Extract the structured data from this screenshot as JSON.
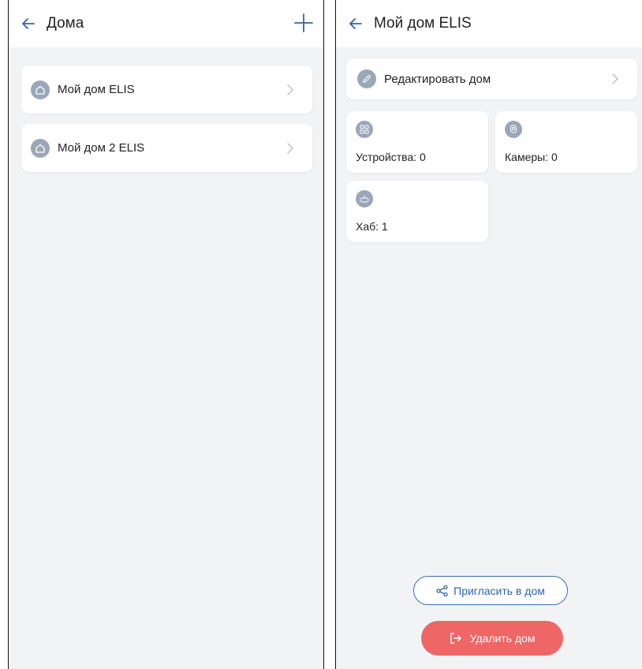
{
  "left_screen": {
    "header": {
      "title": "Дома",
      "back_icon": "arrow-left-icon",
      "add_icon": "plus-icon"
    },
    "homes": [
      {
        "name": "Мой дом ELIS",
        "icon": "home-icon"
      },
      {
        "name": "Мой дом 2 ELIS",
        "icon": "home-icon"
      }
    ]
  },
  "right_screen": {
    "header": {
      "title": "Мой дом ELIS",
      "back_icon": "arrow-left-icon"
    },
    "edit": {
      "label": "Редактировать дом",
      "icon": "pencil-icon"
    },
    "tiles": [
      {
        "label": "Устройства: 0",
        "icon": "devices-grid-icon"
      },
      {
        "label": "Камеры: 0",
        "icon": "camera-icon"
      },
      {
        "label": "Хаб: 1",
        "icon": "hub-icon"
      }
    ],
    "invite_label": "Пригласить в дом",
    "delete_label": "Удалить дом"
  },
  "colors": {
    "accent": "#2f63ad",
    "danger": "#ee6666",
    "background": "#f2f3f5",
    "icon_bg": "#9aa7b9"
  }
}
